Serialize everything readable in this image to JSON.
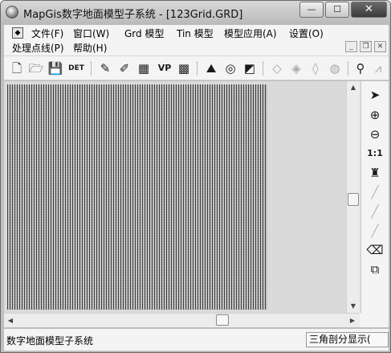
{
  "window": {
    "title": "MapGis数字地面模型子系统 - [123Grid.GRD]",
    "minimize_glyph": "—",
    "maximize_glyph": "☐",
    "close_glyph": "✕"
  },
  "menubar": {
    "row1": [
      {
        "label": "文件(F)"
      },
      {
        "label": "窗口(W)"
      },
      {
        "label": "Grd 模型"
      },
      {
        "label": "Tin 模型"
      },
      {
        "label": "模型应用(A)"
      },
      {
        "label": "设置(O)"
      }
    ],
    "row2": [
      {
        "label": "处理点线(P)"
      },
      {
        "label": "帮助(H)"
      }
    ],
    "doc_icon": "◆",
    "mdi_min": "_",
    "mdi_max": "❐",
    "mdi_close": "✕"
  },
  "toolbar": {
    "icons": [
      {
        "name": "new-file-icon",
        "glyph": "🗋"
      },
      {
        "name": "open-folder-icon",
        "glyph": "🗁"
      },
      {
        "name": "save-icon",
        "glyph": "💾"
      },
      {
        "name": "delete-det-icon",
        "glyph": "DET"
      },
      {
        "name": "pencil-icon",
        "glyph": "✎"
      },
      {
        "name": "pencil-alt-icon",
        "glyph": "✐"
      },
      {
        "name": "grid-icon",
        "glyph": "▦"
      },
      {
        "name": "vp-icon",
        "glyph": "VP"
      },
      {
        "name": "dot-grid-icon",
        "glyph": "▩"
      },
      {
        "name": "terrain-icon",
        "glyph": "⛰"
      },
      {
        "name": "contour-icon",
        "glyph": "◎"
      },
      {
        "name": "surface-icon",
        "glyph": "◩"
      },
      {
        "name": "tin-icon-1",
        "glyph": "◇"
      },
      {
        "name": "tin-icon-2",
        "glyph": "◈"
      },
      {
        "name": "tin-icon-3",
        "glyph": "◊"
      },
      {
        "name": "tin-icon-4",
        "glyph": "◍"
      },
      {
        "name": "probe-icon",
        "glyph": "⚲"
      },
      {
        "name": "profile-icon",
        "glyph": "⩘"
      }
    ]
  },
  "right_tools": {
    "icons": [
      {
        "name": "select-arrow-icon",
        "glyph": "➤"
      },
      {
        "name": "zoom-in-icon",
        "glyph": "⊕"
      },
      {
        "name": "zoom-out-icon",
        "glyph": "⊖"
      },
      {
        "name": "zoom-1to1-icon",
        "glyph": "1:1"
      },
      {
        "name": "brush-icon",
        "glyph": "♜"
      },
      {
        "name": "pen-1-icon",
        "glyph": "╱"
      },
      {
        "name": "pen-2-icon",
        "glyph": "╱"
      },
      {
        "name": "pen-3-icon",
        "glyph": "╱"
      },
      {
        "name": "eraser-icon",
        "glyph": "⌫"
      },
      {
        "name": "layers-icon",
        "glyph": "⧉"
      }
    ]
  },
  "scroll": {
    "up_arrow": "▲",
    "down_arrow": "▼",
    "left_arrow": "◀",
    "right_arrow": "▶"
  },
  "statusbar": {
    "left_text": "数字地面模型子系统",
    "right_text": "三角剖分显示("
  }
}
